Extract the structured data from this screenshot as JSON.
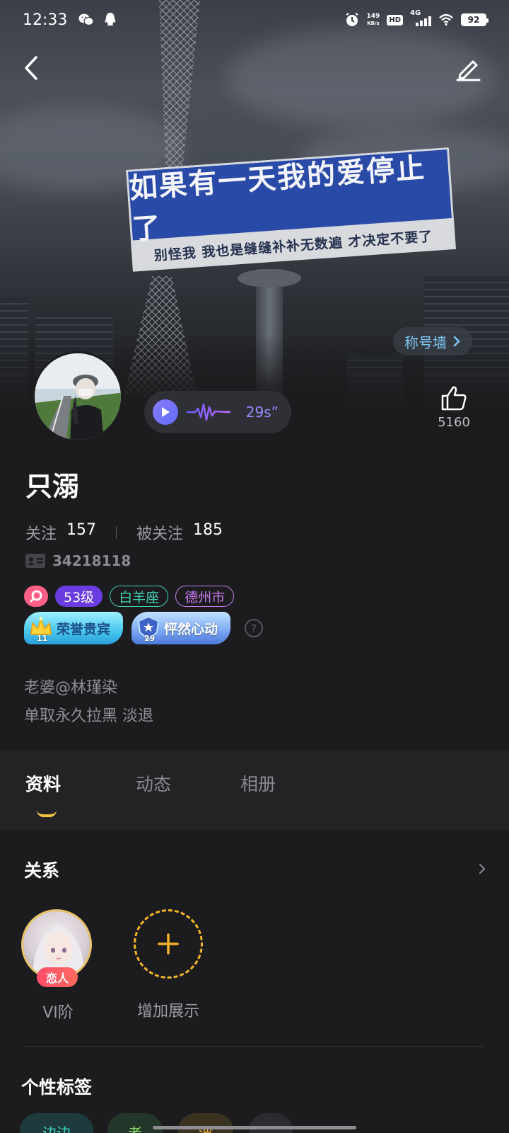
{
  "status_bar": {
    "time": "12:33",
    "net_speed_value": "149",
    "net_speed_unit": "KB/s",
    "hd": "HD",
    "network": "4G",
    "battery": "92"
  },
  "banner": {
    "sign_main": "如果有一天我的爱停止了",
    "sign_sub": "别怪我 我也是缝缝补补无数遍 才决定不要了"
  },
  "header": {
    "title_wall": "称号墙"
  },
  "voice": {
    "duration": "29s”"
  },
  "likes": {
    "count": "5160"
  },
  "profile": {
    "username": "只溺",
    "following_label": "关注",
    "following_count": "157",
    "followers_label": "被关注",
    "followers_count": "185",
    "user_id": "34218118",
    "level": "53级",
    "zodiac": "白羊座",
    "city": "德州市",
    "medals": [
      {
        "label": "荣誉贵宾",
        "number": "11"
      },
      {
        "label": "怦然心动",
        "number": "29"
      }
    ],
    "help": "?",
    "bio_lines": [
      "老婆@林瑾染",
      "单取永久拉黑  淡退"
    ]
  },
  "tabs": [
    {
      "label": "资料"
    },
    {
      "label": "动态"
    },
    {
      "label": "相册"
    }
  ],
  "relation": {
    "title": "关系",
    "items": [
      {
        "badge": "恋人",
        "label": "VI阶"
      },
      {
        "label": "增加展示"
      }
    ]
  },
  "personal_tags": {
    "title": "个性标签",
    "tags": [
      "边边",
      "老",
      "波",
      ""
    ]
  },
  "colors": {
    "accent_gold": "#f5c842",
    "title_wall_blue": "#7cc7f5",
    "level_purple": "#6a3de0",
    "zodiac_green": "#3fd0b0",
    "city_purple": "#c87cf0",
    "lover_red": "#ff4d6a"
  }
}
